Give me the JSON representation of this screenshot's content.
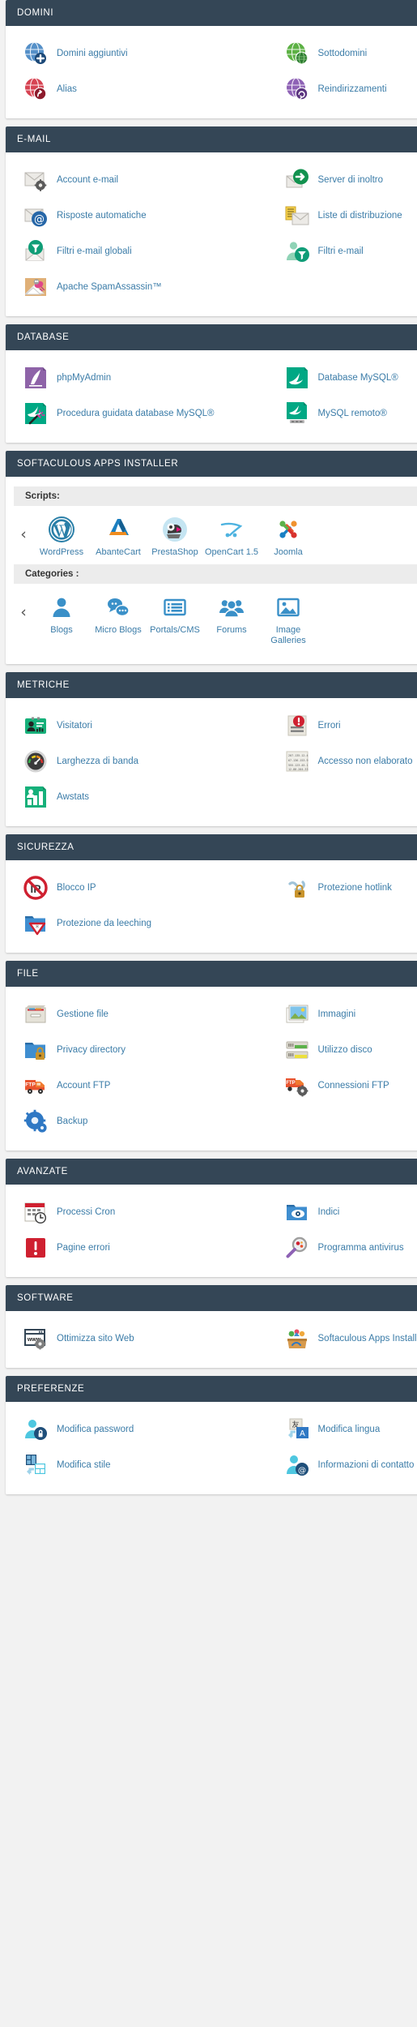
{
  "sections": [
    {
      "id": "domini",
      "title": "DOMINI",
      "items": [
        {
          "label": "Domini aggiuntivi",
          "icon": "globe-plus-icon"
        },
        {
          "label": "Sottodomini",
          "icon": "globe-green-icon"
        },
        {
          "label": "Alias",
          "icon": "globe-red-arrow-icon"
        },
        {
          "label": "Reindirizzamenti",
          "icon": "globe-purple-redirect-icon"
        }
      ]
    },
    {
      "id": "email",
      "title": "E-MAIL",
      "items": [
        {
          "label": "Account e-mail",
          "icon": "envelope-gear-icon"
        },
        {
          "label": "Server di inoltro",
          "icon": "envelope-forward-icon"
        },
        {
          "label": "Risposte automatiche",
          "icon": "envelope-at-icon"
        },
        {
          "label": "Liste di distribuzione",
          "icon": "envelope-list-icon"
        },
        {
          "label": "Filtri e-mail globali",
          "icon": "envelope-funnel-icon"
        },
        {
          "label": "Filtri e-mail",
          "icon": "user-funnel-icon"
        },
        {
          "label": "Apache SpamAssassin™",
          "icon": "spamassassin-icon"
        }
      ]
    },
    {
      "id": "database",
      "title": "DATABASE",
      "items": [
        {
          "label": "phpMyAdmin",
          "icon": "phpmyadmin-icon"
        },
        {
          "label": "Database MySQL®",
          "icon": "mysql-dolphin-icon"
        },
        {
          "label": "Procedura guidata database MySQL®",
          "icon": "mysql-wizard-icon"
        },
        {
          "label": "MySQL remoto®",
          "icon": "mysql-remote-icon"
        }
      ]
    },
    {
      "id": "softaculous",
      "title": "SOFTACULOUS APPS INSTALLER",
      "scripts_label": "Scripts:",
      "categories_label": "Categories :",
      "prev_arrow": "‹",
      "next_arrow": "›",
      "scripts": [
        {
          "label": "WordPress",
          "icon": "wordpress-icon"
        },
        {
          "label": "AbanteCart",
          "icon": "abantecart-icon"
        },
        {
          "label": "PrestaShop",
          "icon": "prestashop-icon"
        },
        {
          "label": "OpenCart 1.5",
          "icon": "opencart-icon"
        },
        {
          "label": "Joomla",
          "icon": "joomla-icon"
        }
      ],
      "categories": [
        {
          "label": "Blogs",
          "icon": "person-icon"
        },
        {
          "label": "Micro Blogs",
          "icon": "chat-bubbles-icon"
        },
        {
          "label": "Portals/CMS",
          "icon": "list-window-icon"
        },
        {
          "label": "Forums",
          "icon": "people-group-icon"
        },
        {
          "label": "Image Galleries",
          "icon": "image-frame-icon"
        }
      ]
    },
    {
      "id": "metriche",
      "title": "METRICHE",
      "items": [
        {
          "label": "Visitatori",
          "icon": "visitor-badge-icon"
        },
        {
          "label": "Errori",
          "icon": "error-document-icon"
        },
        {
          "label": "Larghezza di banda",
          "icon": "bandwidth-gauge-icon"
        },
        {
          "label": "Accesso non elaborato",
          "icon": "raw-access-log-icon"
        },
        {
          "label": "Awstats",
          "icon": "awstats-chart-icon"
        }
      ]
    },
    {
      "id": "sicurezza",
      "title": "SICUREZZA",
      "items": [
        {
          "label": "Blocco IP",
          "icon": "ip-blocker-icon"
        },
        {
          "label": "Protezione hotlink",
          "icon": "hotlink-chain-lock-icon"
        },
        {
          "label": "Protezione da leeching",
          "icon": "leech-protect-folder-icon"
        }
      ]
    },
    {
      "id": "file",
      "title": "FILE",
      "items": [
        {
          "label": "Gestione file",
          "icon": "file-manager-icon"
        },
        {
          "label": "Immagini",
          "icon": "images-icon"
        },
        {
          "label": "Privacy directory",
          "icon": "folder-lock-icon"
        },
        {
          "label": "Utilizzo disco",
          "icon": "disk-usage-icon"
        },
        {
          "label": "Account FTP",
          "icon": "ftp-truck-icon"
        },
        {
          "label": "Connessioni FTP",
          "icon": "ftp-truck-gear-icon"
        },
        {
          "label": "Backup",
          "icon": "backup-gear-icon"
        }
      ]
    },
    {
      "id": "avanzate",
      "title": "AVANZATE",
      "items": [
        {
          "label": "Processi Cron",
          "icon": "cron-calendar-clock-icon"
        },
        {
          "label": "Indici",
          "icon": "folder-eye-icon"
        },
        {
          "label": "Pagine errori",
          "icon": "error-pages-icon"
        },
        {
          "label": "Programma antivirus",
          "icon": "antivirus-magnifier-icon"
        }
      ]
    },
    {
      "id": "software",
      "title": "SOFTWARE",
      "items": [
        {
          "label": "Ottimizza sito Web",
          "icon": "optimize-website-icon"
        },
        {
          "label": "Softaculous Apps Installer",
          "icon": "softaculous-basket-icon"
        }
      ]
    },
    {
      "id": "preferenze",
      "title": "PREFERENZE",
      "items": [
        {
          "label": "Modifica password",
          "icon": "user-password-icon"
        },
        {
          "label": "Modifica lingua",
          "icon": "change-language-icon"
        },
        {
          "label": "Modifica stile",
          "icon": "change-style-icon"
        },
        {
          "label": "Informazioni di contatto",
          "icon": "contact-info-icon"
        }
      ]
    }
  ],
  "colors": {
    "header_bg": "#344656",
    "link": "#3b7ca8",
    "page_bg": "#f2f2f2",
    "panel_bg": "#ffffff",
    "subhead_bg": "#ececec"
  }
}
